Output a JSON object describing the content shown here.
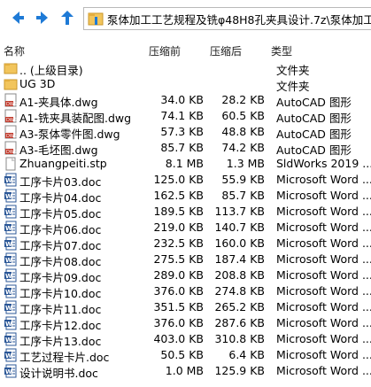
{
  "address": {
    "path": "泵体加工工艺规程及铣φ48H8孔夹具设计.7z\\泵体加工工艺"
  },
  "columns": {
    "name": "名称",
    "before": "压缩前",
    "after": "压缩后",
    "type": "类型"
  },
  "rows": [
    {
      "icon": "folder-up-icon",
      "name": ".. (上级目录)",
      "before": "",
      "after": "",
      "type": "文件夹"
    },
    {
      "icon": "folder-icon",
      "name": "UG 3D",
      "before": "",
      "after": "",
      "type": "文件夹"
    },
    {
      "icon": "dwg-file-icon",
      "name": "A1-夹具体.dwg",
      "before": "34.0 KB",
      "after": "28.2 KB",
      "type": "AutoCAD 图形"
    },
    {
      "icon": "dwg-file-icon",
      "name": "A1-铣夹具装配图.dwg",
      "before": "74.1 KB",
      "after": "60.5 KB",
      "type": "AutoCAD 图形"
    },
    {
      "icon": "dwg-file-icon",
      "name": "A3-泵体零件图.dwg",
      "before": "57.3 KB",
      "after": "48.8 KB",
      "type": "AutoCAD 图形"
    },
    {
      "icon": "dwg-file-icon",
      "name": "A3-毛坯图.dwg",
      "before": "85.7 KB",
      "after": "74.2 KB",
      "type": "AutoCAD 图形"
    },
    {
      "icon": "stp-file-icon",
      "name": "Zhuangpeiti.stp",
      "before": "8.1 MB",
      "after": "1.3 MB",
      "type": "SldWorks 2019 ..."
    },
    {
      "icon": "word-doc-icon",
      "name": "工序卡片03.doc",
      "before": "125.0 KB",
      "after": "55.9 KB",
      "type": "Microsoft Word ..."
    },
    {
      "icon": "word-doc-icon",
      "name": "工序卡片04.doc",
      "before": "162.5 KB",
      "after": "85.7 KB",
      "type": "Microsoft Word ..."
    },
    {
      "icon": "word-doc-icon",
      "name": "工序卡片05.doc",
      "before": "189.5 KB",
      "after": "113.7 KB",
      "type": "Microsoft Word ..."
    },
    {
      "icon": "word-doc-icon",
      "name": "工序卡片06.doc",
      "before": "219.0 KB",
      "after": "140.7 KB",
      "type": "Microsoft Word ..."
    },
    {
      "icon": "word-doc-icon",
      "name": "工序卡片07.doc",
      "before": "232.5 KB",
      "after": "160.0 KB",
      "type": "Microsoft Word ..."
    },
    {
      "icon": "word-doc-icon",
      "name": "工序卡片08.doc",
      "before": "275.5 KB",
      "after": "187.4 KB",
      "type": "Microsoft Word ..."
    },
    {
      "icon": "word-doc-icon",
      "name": "工序卡片09.doc",
      "before": "289.0 KB",
      "after": "208.8 KB",
      "type": "Microsoft Word ..."
    },
    {
      "icon": "word-doc-icon",
      "name": "工序卡片10.doc",
      "before": "376.0 KB",
      "after": "274.8 KB",
      "type": "Microsoft Word ..."
    },
    {
      "icon": "word-doc-icon",
      "name": "工序卡片11.doc",
      "before": "351.5 KB",
      "after": "265.2 KB",
      "type": "Microsoft Word ..."
    },
    {
      "icon": "word-doc-icon",
      "name": "工序卡片12.doc",
      "before": "376.0 KB",
      "after": "287.6 KB",
      "type": "Microsoft Word ..."
    },
    {
      "icon": "word-doc-icon",
      "name": "工序卡片13.doc",
      "before": "403.0 KB",
      "after": "310.8 KB",
      "type": "Microsoft Word ..."
    },
    {
      "icon": "word-doc-icon",
      "name": "工艺过程卡片.doc",
      "before": "50.5 KB",
      "after": "6.4 KB",
      "type": "Microsoft Word ..."
    },
    {
      "icon": "word-doc-icon",
      "name": "设计说明书.doc",
      "before": "1.0 MB",
      "after": "125.9 KB",
      "type": "Microsoft Word ..."
    }
  ],
  "colors": {
    "accent": "#1e7ad6",
    "folder": "#f2c55c",
    "word": "#2b5797"
  }
}
